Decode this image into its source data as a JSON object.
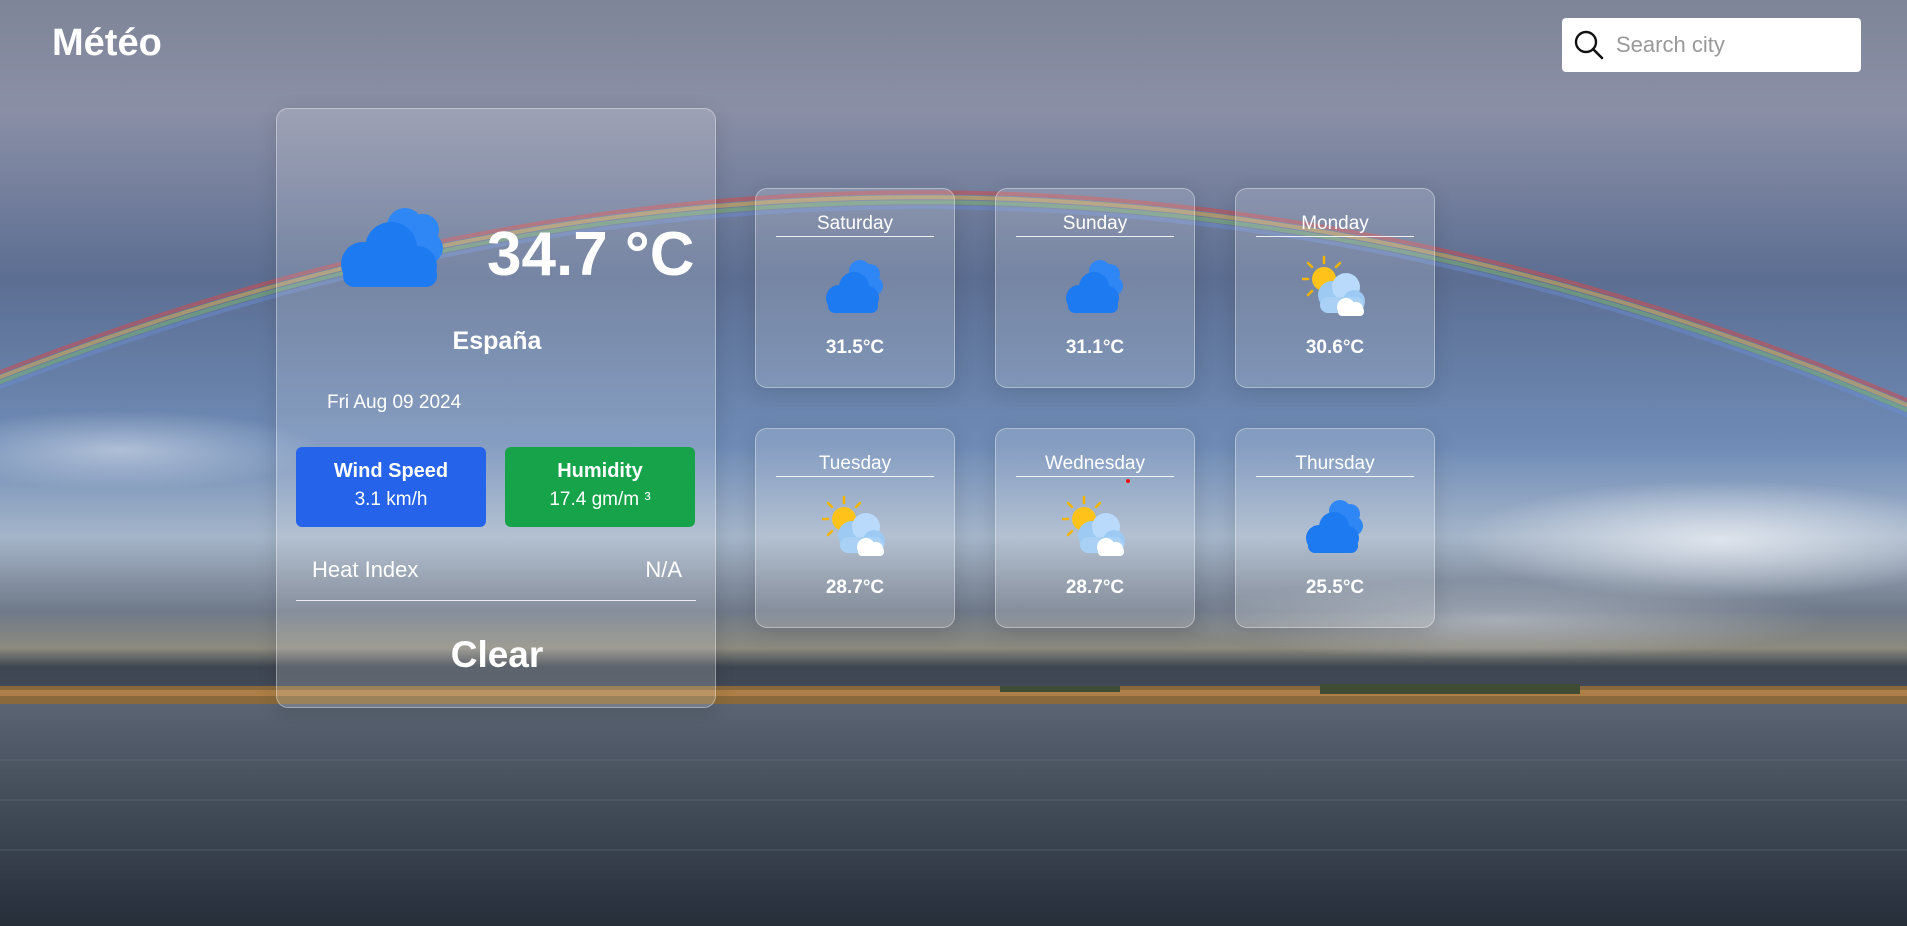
{
  "app": {
    "title": "Météo"
  },
  "search": {
    "placeholder": "Search city",
    "icon": "search-icon"
  },
  "current": {
    "temperature": "34.7 °C",
    "location": "España",
    "date": "Fri Aug 09 2024",
    "icon": "cloud-icon",
    "wind": {
      "label": "Wind Speed",
      "value": "3.1 km/h",
      "color": "#2563eb"
    },
    "humidity": {
      "label": "Humidity",
      "value": "17.4 gm/m ³",
      "color": "#16a34a"
    },
    "heat_index": {
      "label": "Heat Index",
      "value": "N/A"
    },
    "condition": "Clear"
  },
  "forecast": [
    {
      "day": "Saturday",
      "temp": "31.5°C",
      "icon": "cloud-icon"
    },
    {
      "day": "Sunday",
      "temp": "31.1°C",
      "icon": "cloud-icon"
    },
    {
      "day": "Monday",
      "temp": "30.6°C",
      "icon": "partly-cloudy-icon"
    },
    {
      "day": "Tuesday",
      "temp": "28.7°C",
      "icon": "partly-cloudy-icon"
    },
    {
      "day": "Wednesday",
      "temp": "28.7°C",
      "icon": "partly-cloudy-icon"
    },
    {
      "day": "Thursday",
      "temp": "25.5°C",
      "icon": "cloud-icon"
    }
  ]
}
